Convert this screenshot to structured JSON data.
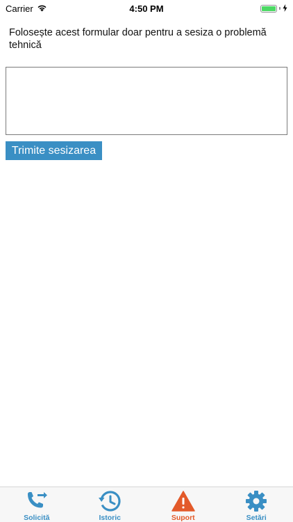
{
  "status_bar": {
    "carrier": "Carrier",
    "time": "4:50 PM",
    "battery_level": 1.0,
    "wifi_icon": "wifi-icon",
    "charging_icon": "lightning-icon"
  },
  "form": {
    "instructions": "Folosește acest formular doar pentru a sesiza o problemă tehnică",
    "textarea_value": "",
    "submit_label": "Trimite sesizarea"
  },
  "tab_bar": {
    "active_tab": "Suport",
    "tabs": [
      {
        "label": "Solicită",
        "icon": "phone-transfer-icon"
      },
      {
        "label": "Istoric",
        "icon": "history-clock-icon"
      },
      {
        "label": "Suport",
        "icon": "warning-triangle-icon"
      },
      {
        "label": "Setări",
        "icon": "gear-icon"
      }
    ]
  },
  "colors": {
    "accent": "#3a8fc4",
    "active_tab": "#e35a2a",
    "battery": "#4cd964"
  }
}
